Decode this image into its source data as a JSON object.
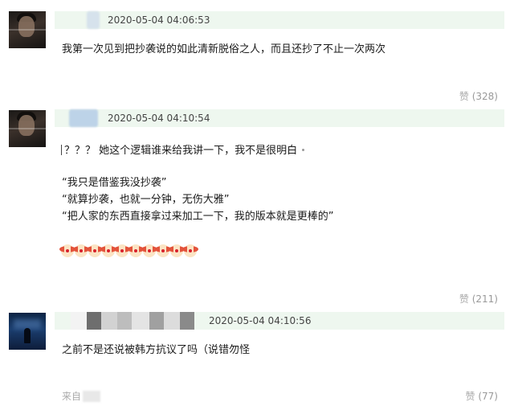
{
  "comments": [
    {
      "date": "2020-05-04 04:06:53",
      "lines": [
        "我第一次见到把抄袭说的如此清新脱俗之人，而且还抄了不止一次两次"
      ],
      "like_label": "赞",
      "like_count": "(328)"
    },
    {
      "date": "2020-05-04 04:10:54",
      "lines": [
        "？？？ 她这个逻辑谁来给我讲一下，我不是很明白",
        "“我只是借鉴我没抄袭”",
        "“就算抄袭，也就一分钟，无伤大雅”",
        "“把人家的东西直接拿过来加工一下，我的版本就是更棒的”"
      ],
      "emoji_name": "clown-face-icon",
      "emoji_count": 10,
      "like_label": "赞",
      "like_count": "(211)"
    },
    {
      "date": "2020-05-04 04:10:56",
      "lines": [
        "之前不是还说被韩方抗议了吗（说错勿怪"
      ],
      "source_label": "来自",
      "like_label": "赞",
      "like_count": "(77)"
    }
  ]
}
